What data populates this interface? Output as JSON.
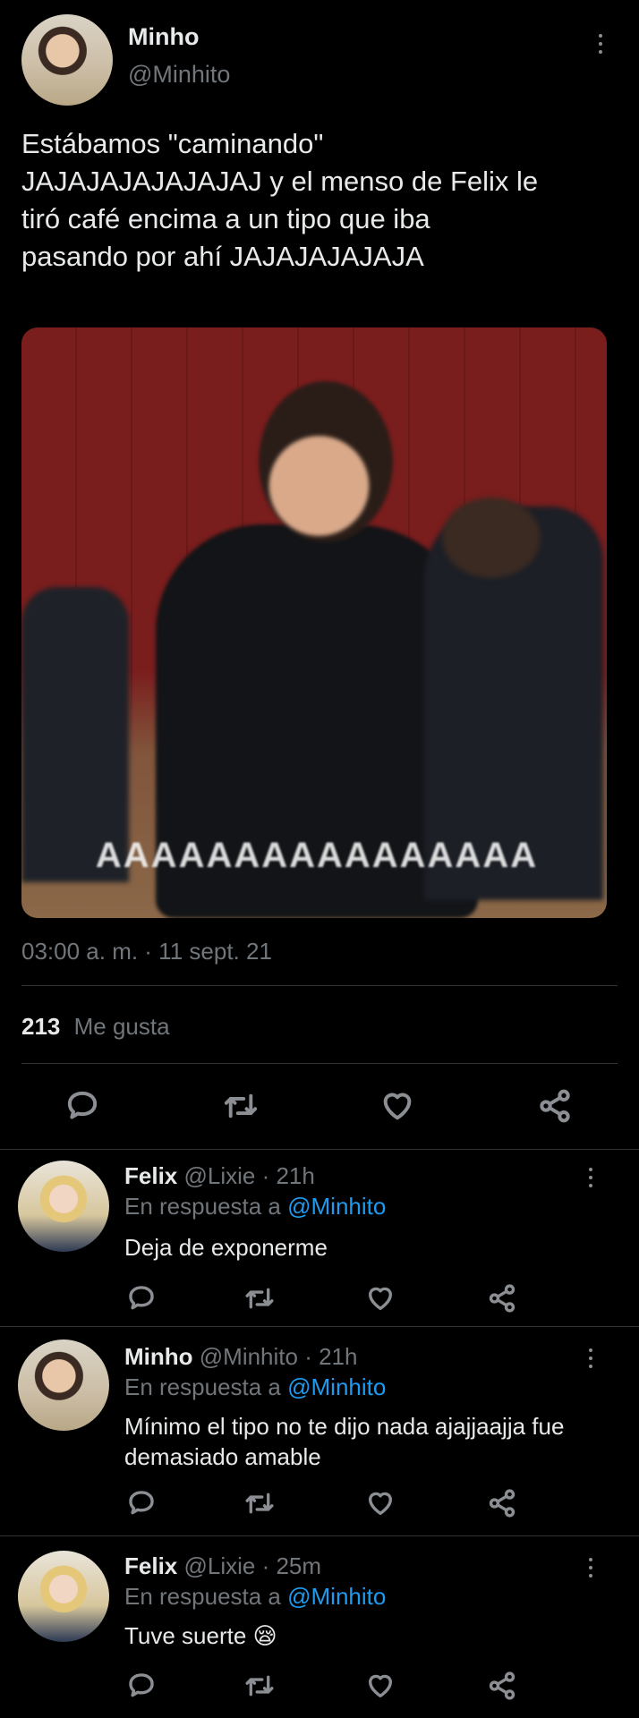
{
  "main_tweet": {
    "author_name": "Minho",
    "author_handle": "@Minhito",
    "text_lines": [
      "Estábamos \"caminando\"",
      "JAJAJAJAJAJAJAJ y el menso de Felix le",
      "tiró café encima a un tipo que iba",
      "pasando por ahí JAJAJAJAJAJA"
    ],
    "media_caption": "AAAAAAAAAAAAAAAA",
    "timestamp": "03:00 a. m. · 11 sept. 21",
    "likes_count": "213",
    "likes_label": "Me gusta"
  },
  "replies": [
    {
      "name": "Felix",
      "handle": "@Lixie",
      "time": "· 21h",
      "reply_prefix": "En respuesta a",
      "reply_to": "@Minhito",
      "text_lines": [
        "Deja de exponerme"
      ]
    },
    {
      "name": "Minho",
      "handle": "@Minhito",
      "time": "· 21h",
      "reply_prefix": "En respuesta a",
      "reply_to": "@Minhito",
      "text_lines": [
        "Mínimo el tipo no te dijo nada ajajjaajja fue",
        "demasiado amable"
      ]
    },
    {
      "name": "Felix",
      "handle": "@Lixie",
      "time": "· 25m",
      "reply_prefix": "En respuesta a",
      "reply_to": "@Minhito",
      "text_lines": [
        "Tuve suerte 😪"
      ]
    }
  ],
  "icons": {
    "reply": "speech-bubble-icon",
    "retweet": "retweet-arrows-icon",
    "like": "heart-icon",
    "share": "share-nodes-icon",
    "more": "vertical-dots-icon"
  },
  "colors": {
    "background": "#000000",
    "text": "#e7e9ea",
    "muted": "#71767b",
    "link": "#1d9bf0",
    "divider": "#2f3336"
  }
}
